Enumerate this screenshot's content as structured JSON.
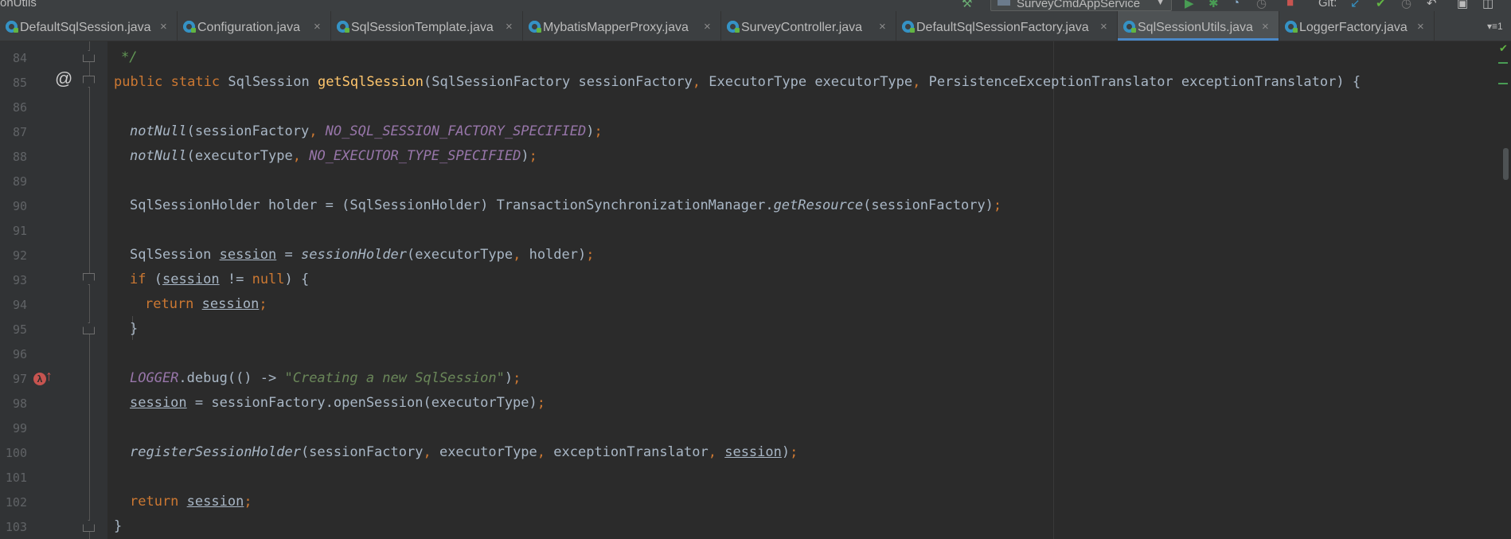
{
  "topbar": {
    "project_name": "onUtils",
    "run_config": "SurveyCmdAppService",
    "git_label": "Git:"
  },
  "tabs": [
    {
      "label": "DefaultSqlSession.java",
      "active": false
    },
    {
      "label": "Configuration.java",
      "active": false
    },
    {
      "label": "SqlSessionTemplate.java",
      "active": false
    },
    {
      "label": "MybatisMapperProxy.java",
      "active": false
    },
    {
      "label": "SurveyController.java",
      "active": false
    },
    {
      "label": "DefaultSqlSessionFactory.java",
      "active": false
    },
    {
      "label": "SqlSessionUtils.java",
      "active": true
    },
    {
      "label": "LoggerFactory.java",
      "active": false
    }
  ],
  "tab_close_glyph": "×",
  "tab_menu": "▾≡1",
  "line_numbers": [
    "84",
    "85",
    "86",
    "87",
    "88",
    "89",
    "90",
    "91",
    "92",
    "93",
    "94",
    "95",
    "96",
    "97",
    "98",
    "99",
    "100",
    "101",
    "102",
    "103"
  ],
  "code": {
    "l84": "*/",
    "l85": {
      "public": "public",
      "static": "static",
      "ret": "SqlSession",
      "name": "getSqlSession",
      "p1": "(SqlSessionFactory sessionFactory",
      "p2": " ExecutorType executorType",
      "p3": " PersistenceExceptionTranslator exceptionTranslator) {"
    },
    "l87": {
      "fn": "notNull",
      "args": "(sessionFactory",
      "const": "NO_SQL_SESSION_FACTORY_SPECIFIED",
      "end": ")"
    },
    "l88": {
      "fn": "notNull",
      "args": "(executorType",
      "const": "NO_EXECUTOR_TYPE_SPECIFIED",
      "end": ")"
    },
    "l90": {
      "a": "SqlSessionHolder holder = (SqlSessionHolder) TransactionSynchronizationManager.",
      "m": "getResource",
      "b": "(sessionFactory)"
    },
    "l92": {
      "a": "SqlSession ",
      "v": "session",
      "b": " = ",
      "m": "sessionHolder",
      "c": "(executorType",
      "d": " holder)"
    },
    "l93": {
      "if": "if",
      "a": " (",
      "v": "session",
      "b": " != ",
      "null": "null",
      "c": ") {"
    },
    "l94": {
      "ret": "return",
      "v": "session"
    },
    "l95": "}",
    "l97": {
      "logger": "LOGGER",
      "a": ".debug(() -> ",
      "str": "\"Creating a new SqlSession\"",
      "b": ")"
    },
    "l98": {
      "v": "session",
      "a": " = sessionFactory.openSession(executorType)"
    },
    "l100": {
      "m": "registerSessionHolder",
      "a": "(sessionFactory",
      "b": " executorType",
      "c": " exceptionTranslator",
      "v": "session",
      "d": ")"
    },
    "l102": {
      "ret": "return",
      "v": "session"
    },
    "l103": "}"
  },
  "colors": {
    "editor_bg": "#2B2B2B",
    "keyword": "#CC7832",
    "method": "#FFC66D",
    "constant": "#9876AA",
    "string": "#6A8759",
    "text": "#A9B7C6",
    "active_tab_underline": "#4A88C7"
  },
  "icons": [
    "hammer-icon",
    "run-icon",
    "debug-icon",
    "coverage-icon",
    "profile-icon",
    "stop-icon",
    "git-update-icon",
    "git-commit-icon",
    "history-icon",
    "revert-icon",
    "at-override-icon",
    "lambda-up-icon",
    "inspection-ok-icon"
  ]
}
